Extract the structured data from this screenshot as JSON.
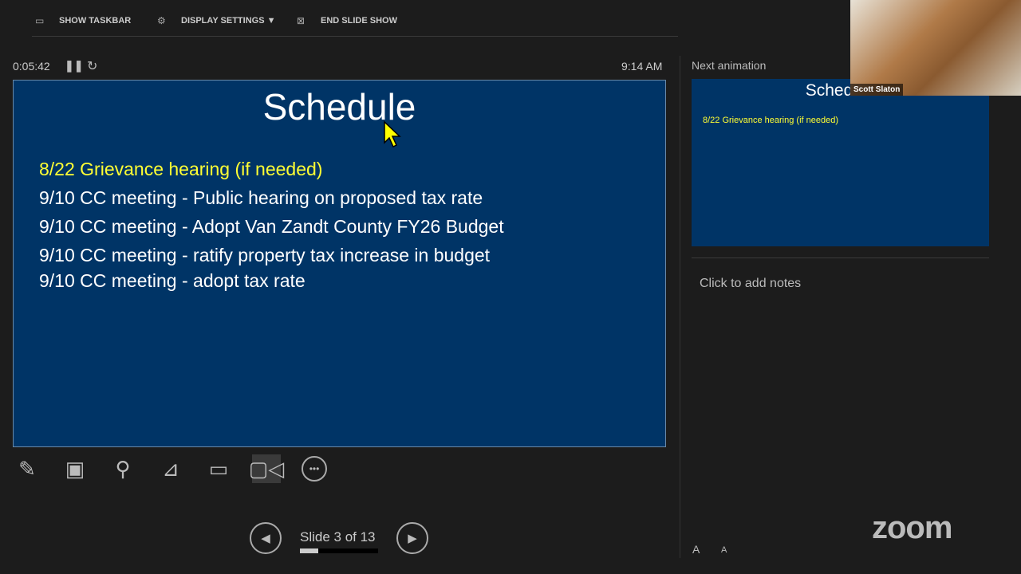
{
  "toolbar": {
    "show_taskbar": "SHOW TASKBAR",
    "display_settings": "DISPLAY SETTINGS ▼",
    "end_slide_show": "END SLIDE SHOW"
  },
  "timer": {
    "elapsed": "0:05:42",
    "clock": "9:14 AM"
  },
  "slide": {
    "title": "Schedule",
    "lines": [
      "8/22 Grievance hearing (if needed)",
      "9/10 CC meeting - Public hearing on proposed tax rate",
      "9/10 CC meeting - Adopt Van Zandt County FY26 Budget",
      "9/10 CC meeting - ratify property tax increase in budget",
      "9/10 CC meeting - adopt tax rate"
    ],
    "highlight_color": "#ffff33",
    "background": "#003466"
  },
  "navigation": {
    "label": "Slide 3 of 13",
    "progress": 0.23
  },
  "next_panel": {
    "heading": "Next animation",
    "preview_title": "Schedule",
    "preview_line": "8/22 Grievance hearing (if needed)"
  },
  "notes": {
    "placeholder": "Click to add notes"
  },
  "video": {
    "participant": "Scott Slaton"
  },
  "brand": {
    "logo": "zoom"
  },
  "font_size_buttons": {
    "increase": "A",
    "decrease": "A"
  }
}
